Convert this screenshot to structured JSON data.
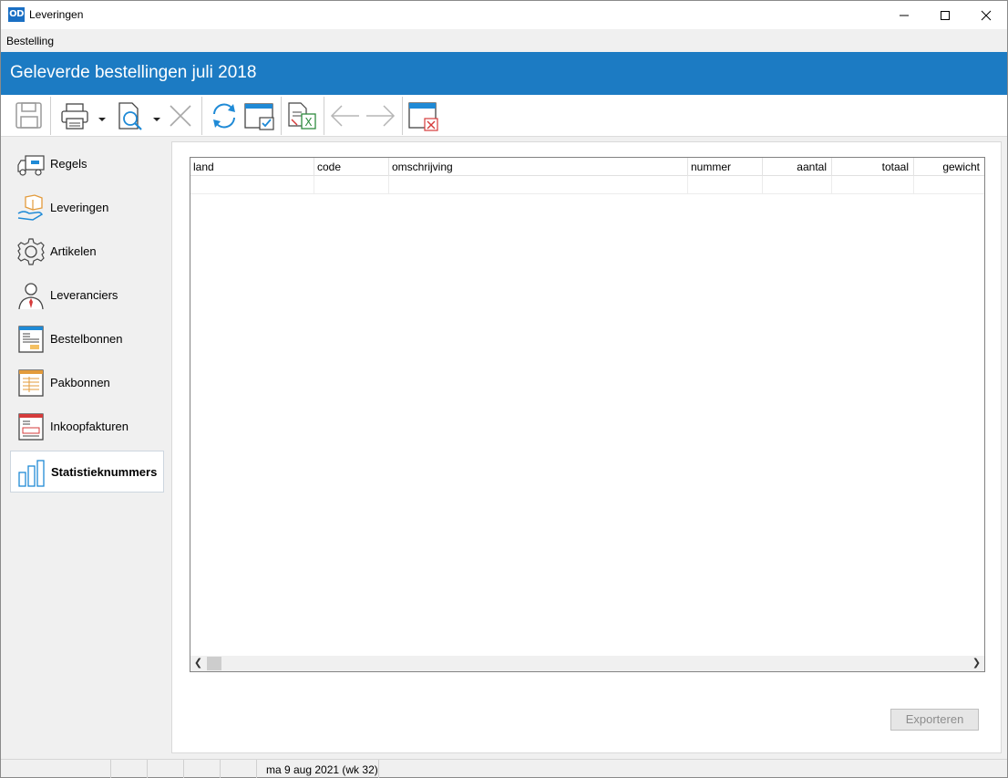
{
  "window": {
    "title": "Leveringen",
    "logo_text": "OD"
  },
  "menu": {
    "items": [
      "Bestelling"
    ]
  },
  "header": {
    "title": "Geleverde bestellingen juli 2018"
  },
  "sidebar": {
    "items": [
      {
        "label": "Regels",
        "icon": "truck-icon"
      },
      {
        "label": "Leveringen",
        "icon": "package-hand-icon"
      },
      {
        "label": "Artikelen",
        "icon": "gear-icon"
      },
      {
        "label": "Leveranciers",
        "icon": "person-icon"
      },
      {
        "label": "Bestelbonnen",
        "icon": "order-form-icon"
      },
      {
        "label": "Pakbonnen",
        "icon": "packing-slip-icon"
      },
      {
        "label": "Inkoopfakturen",
        "icon": "invoice-icon"
      },
      {
        "label": "Statistieknummers",
        "icon": "bar-chart-icon",
        "active": true
      }
    ]
  },
  "grid": {
    "columns": [
      "land",
      "code",
      "omschrijving",
      "nummer",
      "aantal",
      "totaal",
      "gewicht"
    ]
  },
  "buttons": {
    "export_label": "Exporteren"
  },
  "status": {
    "date": "ma 9 aug 2021 (wk 32)"
  },
  "colors": {
    "header_bg": "#1c7bc3",
    "accent_icon": "#1f8ad6"
  }
}
